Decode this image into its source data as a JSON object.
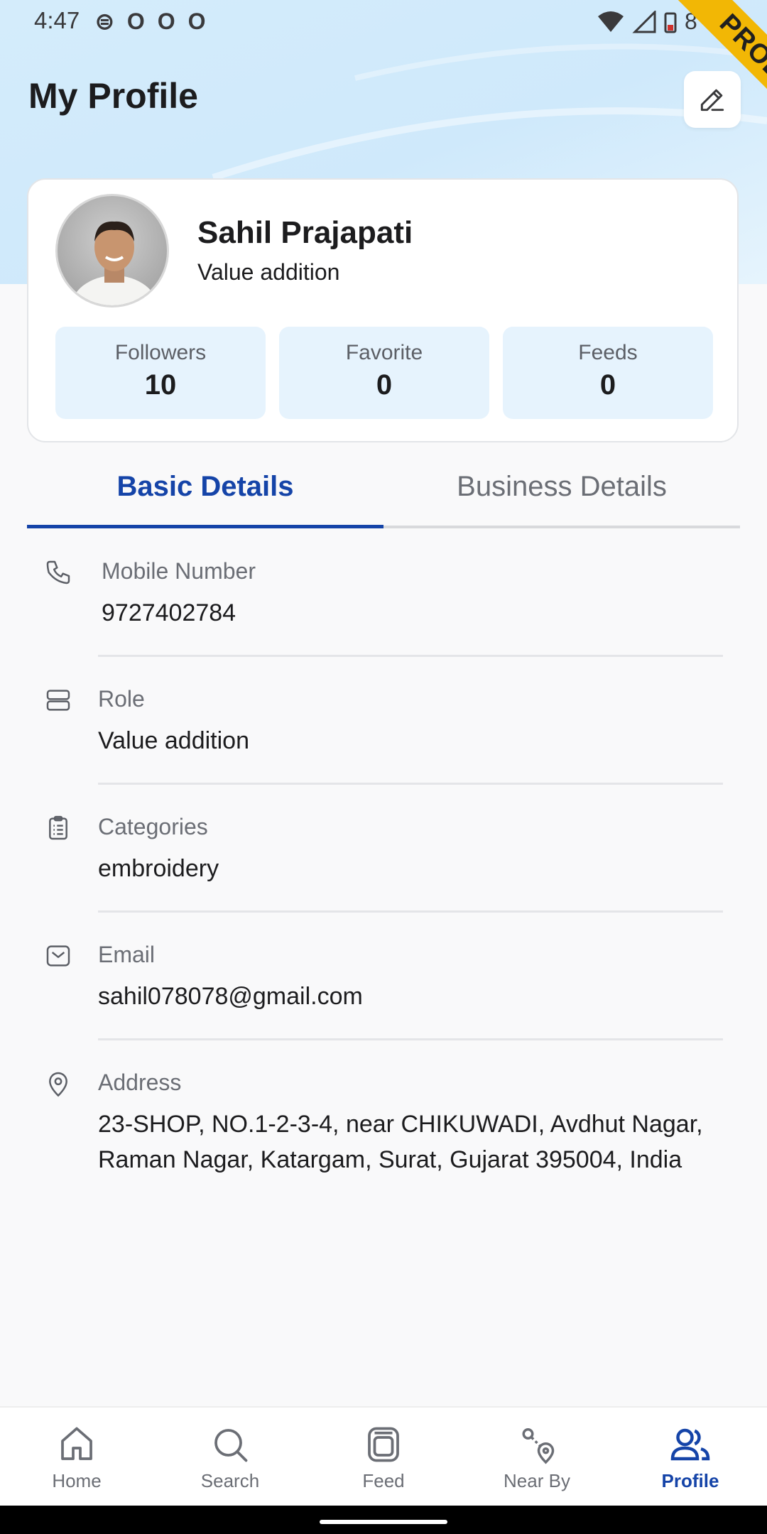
{
  "status_bar": {
    "time": "4:47",
    "left_icons": [
      "sim-icon",
      "notification-icon",
      "notification-icon",
      "notification-icon"
    ],
    "battery_text": "8"
  },
  "ribbon": "PROD",
  "header": {
    "title": "My Profile"
  },
  "profile": {
    "name": "Sahil Prajapati",
    "role": "Value addition",
    "stats": [
      {
        "label": "Followers",
        "value": "10"
      },
      {
        "label": "Favorite",
        "value": "0"
      },
      {
        "label": "Feeds",
        "value": "0"
      }
    ]
  },
  "tabs": [
    {
      "label": "Basic Details",
      "active": true
    },
    {
      "label": "Business Details",
      "active": false
    }
  ],
  "details": [
    {
      "icon": "phone-icon",
      "label": "Mobile Number",
      "value": "9727402784"
    },
    {
      "icon": "role-icon",
      "label": "Role",
      "value": "Value addition"
    },
    {
      "icon": "clipboard-icon",
      "label": "Categories",
      "value": "embroidery"
    },
    {
      "icon": "mail-icon",
      "label": "Email",
      "value": "sahil078078@gmail.com"
    },
    {
      "icon": "location-pin-icon",
      "label": "Address",
      "value": "23-SHOP, NO.1-2-3-4, near CHIKUWADI, Avdhut Nagar, Raman Nagar, Katargam, Surat, Gujarat 395004, India"
    }
  ],
  "bottom_nav": [
    {
      "icon": "home-icon",
      "label": "Home",
      "active": false
    },
    {
      "icon": "search-icon",
      "label": "Search",
      "active": false
    },
    {
      "icon": "feed-icon",
      "label": "Feed",
      "active": false
    },
    {
      "icon": "nearby-icon",
      "label": "Near By",
      "active": false
    },
    {
      "icon": "profile-icon",
      "label": "Profile",
      "active": true
    }
  ],
  "colors": {
    "accent": "#1544a8",
    "stat_bg": "#e6f3fd",
    "ribbon": "#f2b705"
  }
}
